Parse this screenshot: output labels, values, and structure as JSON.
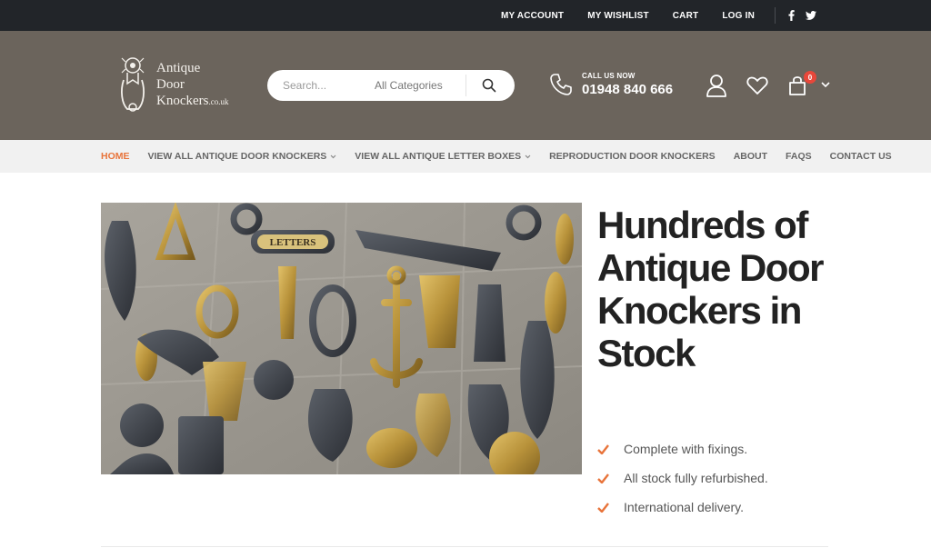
{
  "topbar": {
    "links": [
      "MY ACCOUNT",
      "MY WISHLIST",
      "CART",
      "LOG IN"
    ],
    "social": {
      "facebook_icon": "f",
      "twitter_icon": "twitter-icon"
    }
  },
  "header": {
    "logo_lines": [
      "Antique",
      "Door",
      "Knockers"
    ],
    "logo_suffix": ".co.uk",
    "search_placeholder": "Search...",
    "category_label": "All Categories",
    "call_label": "CALL US NOW",
    "phone_number": "01948 840 666",
    "cart_count": "0"
  },
  "nav": {
    "items": [
      {
        "label": "HOME",
        "active": true,
        "dropdown": false
      },
      {
        "label": "VIEW ALL ANTIQUE DOOR KNOCKERS",
        "active": false,
        "dropdown": true
      },
      {
        "label": "VIEW ALL ANTIQUE LETTER BOXES",
        "active": false,
        "dropdown": true
      },
      {
        "label": "REPRODUCTION DOOR KNOCKERS",
        "active": false,
        "dropdown": false
      },
      {
        "label": "ABOUT",
        "active": false,
        "dropdown": false
      },
      {
        "label": "FAQS",
        "active": false,
        "dropdown": false
      },
      {
        "label": "CONTACT US",
        "active": false,
        "dropdown": false
      }
    ],
    "chevron": "⌄"
  },
  "hero": {
    "headline": "Hundreds of Antique Door Knockers in Stock",
    "image_plaque_text": "LETTERS",
    "features": [
      "Complete with fixings.",
      "All stock fully refurbished.",
      "International delivery."
    ]
  },
  "colors": {
    "topbar_bg": "#222529",
    "header_bg": "#6b645c",
    "nav_bg": "#f1f1f1",
    "accent": "#e8743b",
    "badge": "#e8473a"
  }
}
